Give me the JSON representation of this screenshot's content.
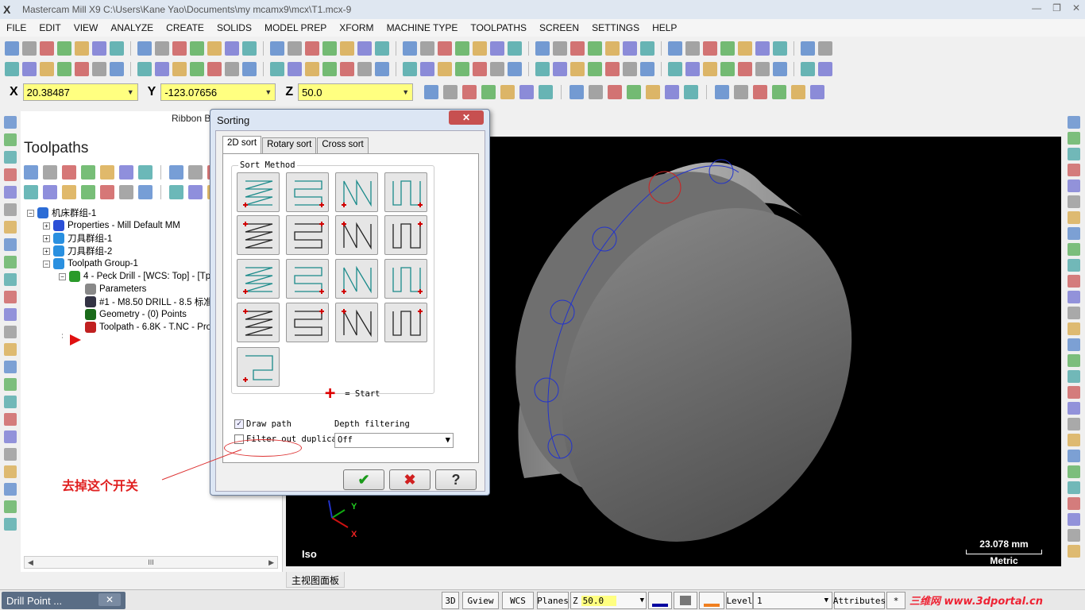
{
  "window": {
    "title": "Mastercam Mill X9  C:\\Users\\Kane Yao\\Documents\\my mcamx9\\mcx\\T1.mcx-9",
    "minimize": "—",
    "restore": "❐",
    "close": "✕"
  },
  "menu": [
    "FILE",
    "EDIT",
    "VIEW",
    "ANALYZE",
    "CREATE",
    "SOLIDS",
    "MODEL PREP",
    "XFORM",
    "MACHINE TYPE",
    "TOOLPATHS",
    "SCREEN",
    "SETTINGS",
    "HELP"
  ],
  "coords": {
    "x_label": "X",
    "x_value": "20.38487",
    "y_label": "Y",
    "y_value": "-123.07656",
    "z_label": "Z",
    "z_value": "50.0"
  },
  "panel": {
    "ribbon_tab": "Ribbon Ba",
    "title": "Toolpaths",
    "tree": [
      {
        "label": "机床群组-1",
        "indent": 0,
        "expander": "−",
        "icon": "machine-group-icon"
      },
      {
        "label": "Properties - Mill Default MM",
        "indent": 1,
        "expander": "+",
        "icon": "properties-icon"
      },
      {
        "label": "刀具群组-1",
        "indent": 1,
        "expander": "+",
        "icon": "tool-group-icon"
      },
      {
        "label": "刀具群组-2",
        "indent": 1,
        "expander": "+",
        "icon": "tool-group-icon"
      },
      {
        "label": "Toolpath Group-1",
        "indent": 1,
        "expander": "−",
        "icon": "toolpath-group-icon"
      },
      {
        "label": "4 - Peck Drill - [WCS: Top] - [Tpl",
        "indent": 2,
        "expander": "−",
        "icon": "operation-icon"
      },
      {
        "label": "Parameters",
        "indent": 3,
        "expander": "",
        "icon": "parameters-icon"
      },
      {
        "label": "#1 - M8.50 DRILL - 8.5 标准",
        "indent": 3,
        "expander": "",
        "icon": "drill-tool-icon"
      },
      {
        "label": "Geometry - (0) Points",
        "indent": 3,
        "expander": "",
        "icon": "geometry-icon"
      },
      {
        "label": "Toolpath - 6.8K - T.NC - Pro",
        "indent": 3,
        "expander": "",
        "icon": "toolpath-dirty-icon"
      }
    ],
    "scroll_mid": "III"
  },
  "viewport": {
    "view_name": "Iso",
    "scale_value": "23.078 mm",
    "scale_unit": "Metric",
    "axis_y": "Y",
    "axis_x": "X",
    "tab_label": "主视图面板"
  },
  "dialog": {
    "title": "Sorting",
    "close": "✕",
    "tabs": [
      "2D sort",
      "Rotary sort",
      "Cross sort"
    ],
    "sort_method_label": "Sort Method",
    "start_legend": "= Start",
    "draw_path_label": "Draw path",
    "draw_path_checked": true,
    "filter_label": "Filter out duplica",
    "filter_checked": false,
    "depth_label": "Depth filtering",
    "depth_value": "Off",
    "ok": "✔",
    "cancel": "✖",
    "help": "?"
  },
  "annotation": "去掉这个开关",
  "status": {
    "task_label": "Drill Point ...",
    "task_close": "✕",
    "btn_3d": "3D",
    "btn_gview": "Gview",
    "btn_wcs": "WCS",
    "btn_planes": "Planes",
    "z_label": "Z",
    "z_value": "50.0",
    "level_label": "Level",
    "level_value": "1",
    "attributes_label": "Attributes",
    "asterisk": "*",
    "watermark": "三维网 www.3dportal.cn"
  },
  "colors": {
    "coord_field": "#ffff80",
    "viewport_bg": "#000000",
    "annotation_red": "#e02020",
    "start_marker": "#d00000",
    "path_teal": "#1a8a8a"
  }
}
